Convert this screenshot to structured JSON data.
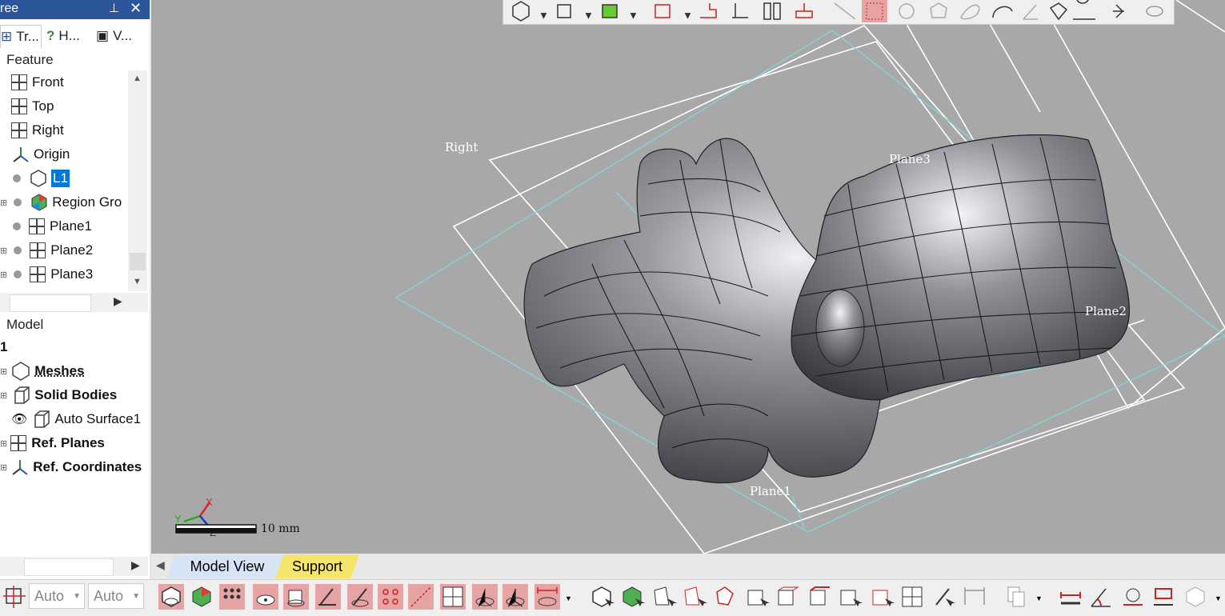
{
  "panel": {
    "title": "ree",
    "tabs": [
      "Tr...",
      "H...",
      "V..."
    ]
  },
  "feature": {
    "heading": "Feature",
    "items": [
      {
        "label": "Front",
        "icon": "plane-icon"
      },
      {
        "label": "Top",
        "icon": "plane-icon"
      },
      {
        "label": "Right",
        "icon": "plane-icon"
      },
      {
        "label": "Origin",
        "icon": "origin-icon"
      },
      {
        "label": "L1",
        "icon": "mesh-icon"
      },
      {
        "label": "Region Gro",
        "icon": "region-icon"
      },
      {
        "label": "Plane1",
        "icon": "plane-icon"
      },
      {
        "label": "Plane2",
        "icon": "plane-icon"
      },
      {
        "label": "Plane3",
        "icon": "plane-icon"
      }
    ]
  },
  "model": {
    "heading": "Model",
    "root": "1",
    "items": [
      {
        "label": "Meshes",
        "bold": true
      },
      {
        "label": "Solid Bodies",
        "bold": true
      },
      {
        "label": "Auto Surface1",
        "bold": false
      },
      {
        "label": "Ref. Planes",
        "bold": true
      },
      {
        "label": "Ref. Coordinates",
        "bold": true
      }
    ]
  },
  "viewport": {
    "labels": {
      "right": "Right",
      "plane1": "Plane1",
      "plane2": "Plane2",
      "plane3": "Plane3"
    },
    "scale": "10 mm",
    "triad": {
      "x": "X",
      "y": "Y",
      "z": "Z"
    }
  },
  "bottom_tabs": {
    "model_view": "Model View",
    "support": "Support"
  },
  "selectors": {
    "first": "Auto",
    "second": "Auto"
  },
  "colors": {
    "accent": "#2b579a",
    "highlight": "#e6a3a3",
    "viewport": "#a8a8a8"
  }
}
